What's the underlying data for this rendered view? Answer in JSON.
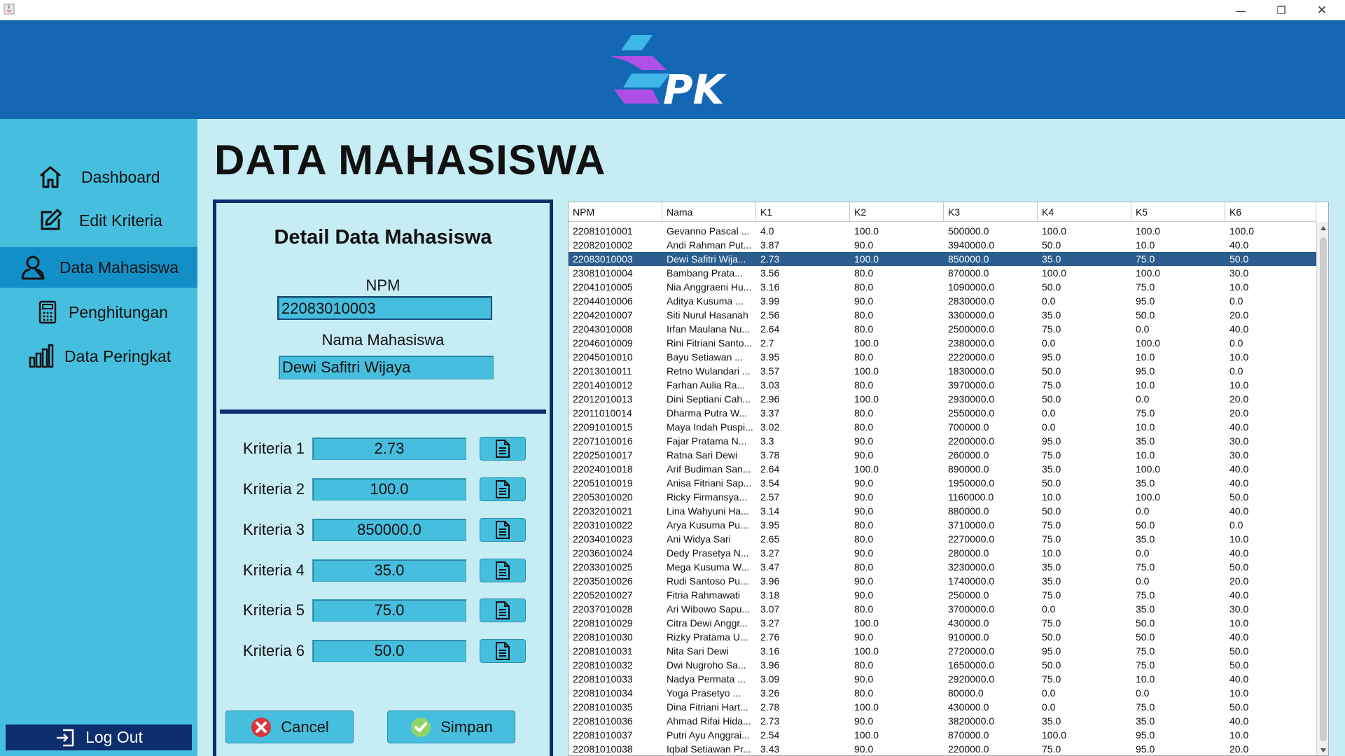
{
  "window": {
    "minimize_glyph": "—",
    "maximize_glyph": "❐",
    "close_glyph": "✕"
  },
  "header": {
    "logo_text": "PK",
    "colors": {
      "bg": "#1468b3",
      "logo_cyan": "#3fb6e8",
      "logo_purple": "#b04fe6"
    }
  },
  "sidebar": {
    "items": [
      {
        "label": "Dashboard",
        "icon": "home-icon",
        "active": false
      },
      {
        "label": "Edit Kriteria",
        "icon": "edit-icon",
        "active": false
      },
      {
        "label": "Data Mahasiswa",
        "icon": "user-icon",
        "active": true
      },
      {
        "label": "Penghitungan",
        "icon": "calculator-icon",
        "active": false
      },
      {
        "label": "Data Peringkat",
        "icon": "bar-chart-icon",
        "active": false
      }
    ],
    "logout_label": "Log Out"
  },
  "page_title": "DATA MAHASISWA",
  "detail": {
    "title": "Detail Data Mahasiswa",
    "npm_label": "NPM",
    "npm_value": "22083010003",
    "nama_label": "Nama Mahasiswa",
    "nama_value": "Dewi Safitri Wijaya",
    "kriteria": [
      {
        "label": "Kriteria 1",
        "value": "2.73"
      },
      {
        "label": "Kriteria 2",
        "value": "100.0"
      },
      {
        "label": "Kriteria 3",
        "value": "850000.0"
      },
      {
        "label": "Kriteria 4",
        "value": "35.0"
      },
      {
        "label": "Kriteria 5",
        "value": "75.0"
      },
      {
        "label": "Kriteria 6",
        "value": "50.0"
      }
    ],
    "cancel_label": "Cancel",
    "save_label": "Simpan"
  },
  "table": {
    "columns": [
      "NPM",
      "Nama",
      "K1",
      "K2",
      "K3",
      "K4",
      "K5",
      "K6"
    ],
    "selected_row": 2,
    "rows": [
      [
        "22081010001",
        "Gevanno Pascal ...",
        "4.0",
        "100.0",
        "500000.0",
        "100.0",
        "100.0",
        "100.0"
      ],
      [
        "22082010002",
        "Andi Rahman Put...",
        "3.87",
        "90.0",
        "3940000.0",
        "50.0",
        "10.0",
        "40.0"
      ],
      [
        "22083010003",
        "Dewi Safitri Wija...",
        "2.73",
        "100.0",
        "850000.0",
        "35.0",
        "75.0",
        "50.0"
      ],
      [
        "23081010004",
        "Bambang Prata...",
        "3.56",
        "80.0",
        "870000.0",
        "100.0",
        "100.0",
        "30.0"
      ],
      [
        "22041010005",
        "Nia Anggraeni Hu...",
        "3.16",
        "80.0",
        "1090000.0",
        "50.0",
        "75.0",
        "10.0"
      ],
      [
        "22044010006",
        "Aditya Kusuma ...",
        "3.99",
        "90.0",
        "2830000.0",
        "0.0",
        "95.0",
        "0.0"
      ],
      [
        "22042010007",
        "Siti Nurul Hasanah",
        "2.56",
        "80.0",
        "3300000.0",
        "35.0",
        "50.0",
        "20.0"
      ],
      [
        "22043010008",
        "Irfan Maulana Nu...",
        "2.64",
        "80.0",
        "2500000.0",
        "75.0",
        "0.0",
        "40.0"
      ],
      [
        "22046010009",
        "Rini Fitriani Santo...",
        "2.7",
        "100.0",
        "2380000.0",
        "0.0",
        "100.0",
        "0.0"
      ],
      [
        "22045010010",
        "Bayu Setiawan ...",
        "3.95",
        "80.0",
        "2220000.0",
        "95.0",
        "10.0",
        "10.0"
      ],
      [
        "22013010011",
        "Retno Wulandari ...",
        "3.57",
        "100.0",
        "1830000.0",
        "50.0",
        "95.0",
        "0.0"
      ],
      [
        "22014010012",
        "Farhan Aulia Ra...",
        "3.03",
        "80.0",
        "3970000.0",
        "75.0",
        "10.0",
        "10.0"
      ],
      [
        "22012010013",
        "Dini Septiani Cah...",
        "2.96",
        "100.0",
        "2930000.0",
        "50.0",
        "0.0",
        "20.0"
      ],
      [
        "22011010014",
        "Dharma Putra W...",
        "3.37",
        "80.0",
        "2550000.0",
        "0.0",
        "75.0",
        "20.0"
      ],
      [
        "22091010015",
        "Maya Indah Puspi...",
        "3.02",
        "80.0",
        "700000.0",
        "0.0",
        "10.0",
        "40.0"
      ],
      [
        "22071010016",
        "Fajar Pratama N...",
        "3.3",
        "90.0",
        "2200000.0",
        "95.0",
        "35.0",
        "30.0"
      ],
      [
        "22025010017",
        "Ratna Sari Dewi",
        "3.78",
        "90.0",
        "260000.0",
        "75.0",
        "10.0",
        "30.0"
      ],
      [
        "22024010018",
        "Arif Budiman San...",
        "2.64",
        "100.0",
        "890000.0",
        "35.0",
        "100.0",
        "40.0"
      ],
      [
        "22051010019",
        "Anisa Fitriani Sap...",
        "3.54",
        "90.0",
        "1950000.0",
        "50.0",
        "35.0",
        "40.0"
      ],
      [
        "22053010020",
        "Ricky Firmansya...",
        "2.57",
        "90.0",
        "1160000.0",
        "10.0",
        "100.0",
        "50.0"
      ],
      [
        "22032010021",
        "Lina Wahyuni Ha...",
        "3.14",
        "90.0",
        "880000.0",
        "50.0",
        "0.0",
        "40.0"
      ],
      [
        "22031010022",
        "Arya Kusuma Pu...",
        "3.95",
        "80.0",
        "3710000.0",
        "75.0",
        "50.0",
        "0.0"
      ],
      [
        "22034010023",
        "Ani Widya Sari",
        "2.65",
        "80.0",
        "2270000.0",
        "75.0",
        "35.0",
        "10.0"
      ],
      [
        "22036010024",
        "Dedy Prasetya N...",
        "3.27",
        "90.0",
        "280000.0",
        "10.0",
        "0.0",
        "40.0"
      ],
      [
        "22033010025",
        "Mega Kusuma W...",
        "3.47",
        "80.0",
        "3230000.0",
        "35.0",
        "75.0",
        "50.0"
      ],
      [
        "22035010026",
        "Rudi Santoso Pu...",
        "3.96",
        "90.0",
        "1740000.0",
        "35.0",
        "0.0",
        "20.0"
      ],
      [
        "22052010027",
        "Fitria Rahmawati",
        "3.18",
        "90.0",
        "250000.0",
        "75.0",
        "75.0",
        "40.0"
      ],
      [
        "22037010028",
        "Ari Wibowo Sapu...",
        "3.07",
        "80.0",
        "3700000.0",
        "0.0",
        "35.0",
        "30.0"
      ],
      [
        "22081010029",
        "Citra Dewi Anggr...",
        "3.27",
        "100.0",
        "430000.0",
        "75.0",
        "50.0",
        "10.0"
      ],
      [
        "22081010030",
        "Rizky Pratama U...",
        "2.76",
        "90.0",
        "910000.0",
        "50.0",
        "50.0",
        "40.0"
      ],
      [
        "22081010031",
        "Nita Sari Dewi",
        "3.16",
        "100.0",
        "2720000.0",
        "95.0",
        "75.0",
        "50.0"
      ],
      [
        "22081010032",
        "Dwi Nugroho Sa...",
        "3.96",
        "80.0",
        "1650000.0",
        "50.0",
        "75.0",
        "50.0"
      ],
      [
        "22081010033",
        "Nadya Permata ...",
        "3.09",
        "90.0",
        "2920000.0",
        "75.0",
        "10.0",
        "40.0"
      ],
      [
        "22081010034",
        "Yoga Prasetyo ...",
        "3.26",
        "80.0",
        "80000.0",
        "0.0",
        "0.0",
        "10.0"
      ],
      [
        "22081010035",
        "Dina Fitriani Hart...",
        "2.78",
        "100.0",
        "430000.0",
        "0.0",
        "75.0",
        "50.0"
      ],
      [
        "22081010036",
        "Ahmad Rifai Hida...",
        "2.73",
        "90.0",
        "3820000.0",
        "35.0",
        "35.0",
        "40.0"
      ],
      [
        "22081010037",
        "Putri Ayu Anggrai...",
        "2.54",
        "100.0",
        "870000.0",
        "100.0",
        "95.0",
        "10.0"
      ],
      [
        "22081010038",
        "Iqbal Setiawan Pr...",
        "3.43",
        "90.0",
        "220000.0",
        "75.0",
        "95.0",
        "20.0"
      ]
    ]
  }
}
